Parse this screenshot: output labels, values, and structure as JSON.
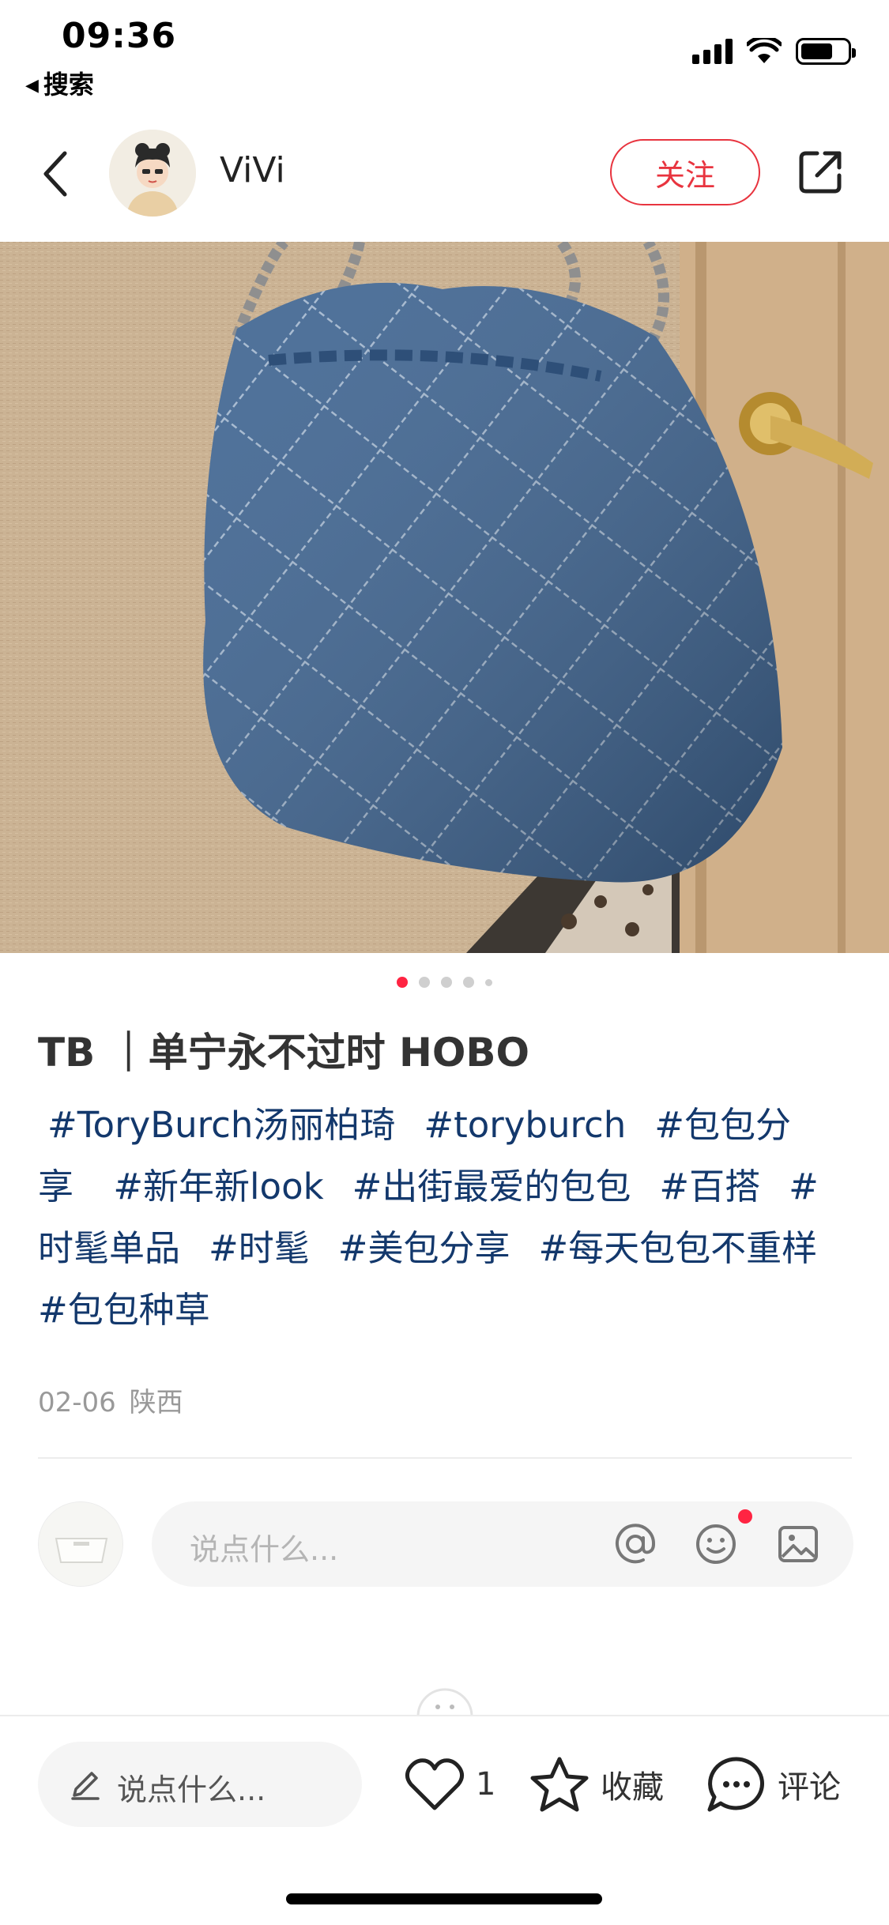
{
  "status_bar": {
    "time": "09:36",
    "back_app_label": "搜索"
  },
  "header": {
    "username": "ViVi",
    "follow_label": "关注"
  },
  "carousel": {
    "image_count": 5,
    "active_index": 0
  },
  "post": {
    "title": "TB ｜单宁永不过时 HOBO",
    "tags": [
      "#ToryBurch汤丽柏琦",
      "#toryburch",
      "#包包分享",
      "#新年新look",
      "#出街最爱的包包",
      "#百搭",
      "#时髦单品",
      "#时髦",
      "#美包分享",
      "#每天包包不重样",
      "#包包种草"
    ],
    "date": "02-06",
    "location": "陕西"
  },
  "comment_input": {
    "placeholder": "说点什么..."
  },
  "bottom_bar": {
    "input_placeholder": "说点什么...",
    "like_count": "1",
    "collect_label": "收藏",
    "comment_label": "评论"
  },
  "colors": {
    "accent": "#ff2442",
    "follow": "#e8343f",
    "tag": "#13386c"
  }
}
